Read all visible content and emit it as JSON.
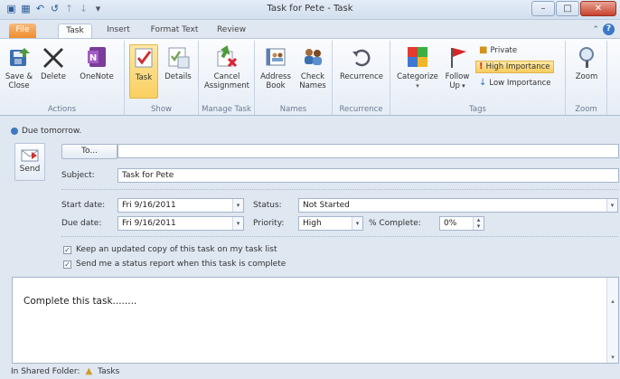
{
  "window": {
    "title": "Task for Pete - Task",
    "buttons": [
      "minimize",
      "maximize",
      "close"
    ]
  },
  "tabs": [
    "File",
    "Task",
    "Insert",
    "Format Text",
    "Review"
  ],
  "active_tab": "Task",
  "ribbon": {
    "actions": {
      "label": "Actions",
      "save_close": [
        "Save &",
        "Close"
      ],
      "delete": "Delete",
      "onenote": "OneNote"
    },
    "show": {
      "label": "Show",
      "task": "Task",
      "details": "Details"
    },
    "manage": {
      "label": "Manage Task",
      "cancel": [
        "Cancel",
        "Assignment"
      ]
    },
    "names": {
      "label": "Names",
      "address_book": [
        "Address",
        "Book"
      ],
      "check_names": [
        "Check",
        "Names"
      ]
    },
    "recurrence": {
      "label": "Recurrence",
      "recurrence": "Recurrence"
    },
    "tags": {
      "label": "Tags",
      "categorize": "Categorize",
      "follow_up": [
        "Follow",
        "Up"
      ],
      "private": "Private",
      "high": "High Importance",
      "low": "Low Importance"
    },
    "zoom": {
      "label": "Zoom",
      "zoom": "Zoom"
    }
  },
  "infobar": "Due tomorrow.",
  "form": {
    "send_label": "Send",
    "to_label": "To...",
    "to_value": "",
    "subject_label": "Subject:",
    "subject_value": "Task for Pete",
    "start_label": "Start date:",
    "start_value": "Fri 9/16/2011",
    "due_label": "Due date:",
    "due_value": "Fri 9/16/2011",
    "status_label": "Status:",
    "status_value": "Not Started",
    "priority_label": "Priority:",
    "priority_value": "High",
    "complete_label": "% Complete:",
    "complete_value": "0%",
    "keep_copy": "Keep an updated copy of this task on my task list",
    "keep_copy_checked": true,
    "send_report": "Send me a status report when this task is complete",
    "send_report_checked": true
  },
  "body_text": "Complete this task........",
  "statusbar": {
    "label": "In Shared Folder:",
    "folder": "Tasks"
  },
  "colors": {
    "accent": "#3d79c3",
    "file_tab": "#f08c2e",
    "selected": "#f9cf60"
  }
}
